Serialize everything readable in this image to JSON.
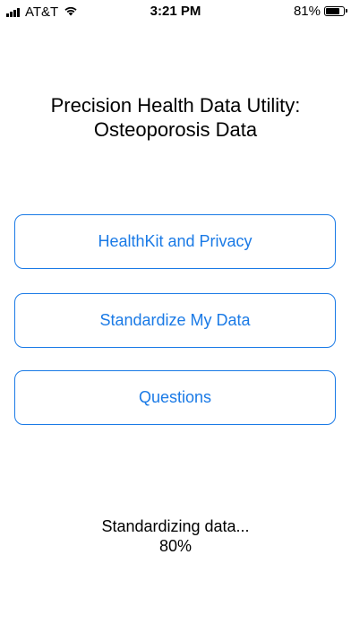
{
  "status_bar": {
    "carrier": "AT&T",
    "time": "3:21 PM",
    "battery_percent": "81%",
    "battery_level": 0.81,
    "signal_bars": 4,
    "icons": [
      "signal-bars-icon",
      "wifi-icon",
      "battery-icon"
    ]
  },
  "title": {
    "line1": "Precision Health Data Utility:",
    "line2": "Osteoporosis Data"
  },
  "buttons": [
    {
      "label": "HealthKit and Privacy"
    },
    {
      "label": "Standardize My Data"
    },
    {
      "label": "Questions"
    }
  ],
  "progress": {
    "status": "Standardizing data...",
    "percent": "80%"
  },
  "colors": {
    "accent": "#1a7ae6",
    "text": "#000000",
    "background": "#ffffff"
  }
}
